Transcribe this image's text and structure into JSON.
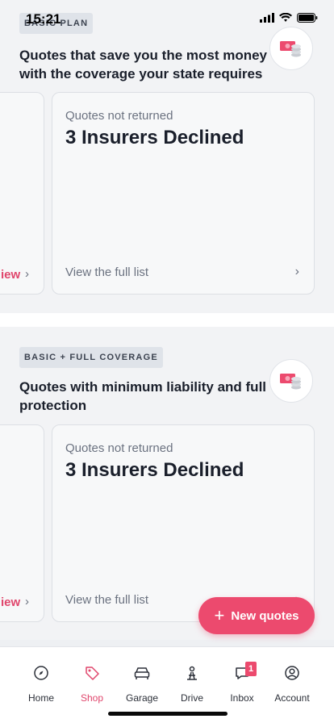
{
  "status_bar": {
    "time": "15:21"
  },
  "sections": [
    {
      "badge": "BASIC PLAN",
      "title": "Quotes that save you the most money with the coverage your state requires",
      "prev_card_link": "iew",
      "card": {
        "subtitle": "Quotes not returned",
        "headline": "3 Insurers Declined",
        "link": "View the full list"
      }
    },
    {
      "badge": "BASIC + FULL COVERAGE",
      "title": "Quotes with minimum liability and full protection",
      "prev_card_link": "iew",
      "card": {
        "subtitle": "Quotes not returned",
        "headline": "3 Insurers Declined",
        "link": "View the full list"
      }
    }
  ],
  "fab": {
    "label": "New quotes"
  },
  "tabs": [
    {
      "label": "Home",
      "icon": "compass-icon"
    },
    {
      "label": "Shop",
      "icon": "tag-icon",
      "active": true
    },
    {
      "label": "Garage",
      "icon": "car-icon"
    },
    {
      "label": "Drive",
      "icon": "road-icon"
    },
    {
      "label": "Inbox",
      "icon": "chat-icon",
      "badge": "1"
    },
    {
      "label": "Account",
      "icon": "user-icon"
    }
  ],
  "colors": {
    "accent": "#ec4a6e",
    "background": "#f2f3f5",
    "badge_bg": "#dfe3e9"
  }
}
